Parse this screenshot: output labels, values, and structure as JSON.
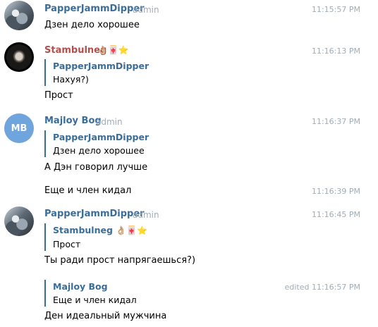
{
  "messages": [
    {
      "author": "PapperJammDipper",
      "role": "admin",
      "time": "11:15:57 PM",
      "text": "Дзен дело хорошее"
    },
    {
      "author": "Stambulneg",
      "emoji": "👌🏼🀄⭐",
      "time": "11:16:13 PM",
      "reply": {
        "author": "PapperJammDipper",
        "text": "Нахуя?)"
      },
      "text": "Прост"
    },
    {
      "author": "Majloy Bog",
      "role": "admin",
      "avatar": "MB",
      "time": "11:16:37 PM",
      "reply": {
        "author": "PapperJammDipper",
        "text": "Дзен дело хорошее"
      },
      "text": "А Дэн говорил лучше"
    },
    {
      "time": "11:16:39 PM",
      "text": "Еще и член кидал"
    },
    {
      "author": "PapperJammDipper",
      "role": "admin",
      "time": "11:16:45 PM",
      "reply": {
        "author": "Stambulneg",
        "emoji": "👌🏼🀄⭐",
        "text": "Прост"
      },
      "text": "Ты ради прост напрягаешься?)"
    },
    {
      "time": "edited 11:16:57 PM",
      "reply": {
        "author": "Majloy Bog",
        "text": "Еще и член кидал"
      },
      "text": "Ден идеальный мужчина"
    }
  ],
  "colors": {
    "name_blue": "#3a6d99",
    "name_red": "#b2504e",
    "meta_gray": "#a0acb6",
    "avatar_mb": "#6fa4dc"
  }
}
